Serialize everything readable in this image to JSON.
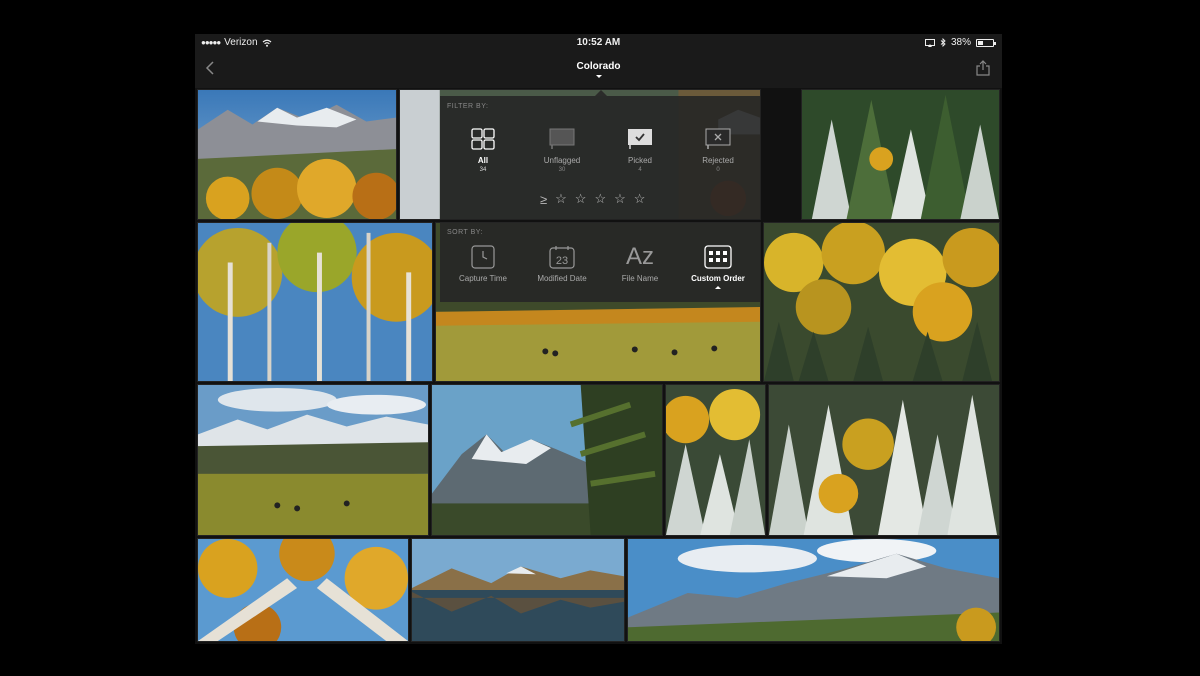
{
  "status_bar": {
    "signal_dots": "●●●●●",
    "carrier": "Verizon",
    "wifi_icon": "wifi-icon",
    "time": "10:52 AM",
    "battery_percent": "38%",
    "battery_level": 0.38
  },
  "nav": {
    "title": "Colorado",
    "back_icon": "chevron-left-icon",
    "share_icon": "share-icon"
  },
  "filter": {
    "label": "FILTER BY:",
    "options": [
      {
        "label": "All",
        "count": "34",
        "icon": "grid-icon",
        "active": true
      },
      {
        "label": "Unflagged",
        "count": "30",
        "icon": "flag-empty-icon",
        "active": false
      },
      {
        "label": "Picked",
        "count": "4",
        "icon": "flag-picked-icon",
        "active": false
      },
      {
        "label": "Rejected",
        "count": "0",
        "icon": "flag-rejected-icon",
        "active": false
      }
    ],
    "rating_operator": "≥",
    "stars": [
      "☆",
      "☆",
      "☆",
      "☆",
      "☆"
    ]
  },
  "sort": {
    "label": "SORT BY:",
    "options": [
      {
        "label": "Capture Time",
        "icon": "clock-icon",
        "active": false
      },
      {
        "label": "Modified Date",
        "icon": "calendar-icon",
        "icon_text": "23",
        "active": false
      },
      {
        "label": "File Name",
        "icon": "az-icon",
        "icon_text": "Az",
        "active": false
      },
      {
        "label": "Custom Order",
        "icon": "custom-order-icon",
        "active": true
      }
    ]
  },
  "colors": {
    "sky": "#4a86c0",
    "aspen_gold": "#d9a21f",
    "forest": "#2e4a2a",
    "meadow": "#8a8a2e",
    "snow": "#e8ecef"
  }
}
